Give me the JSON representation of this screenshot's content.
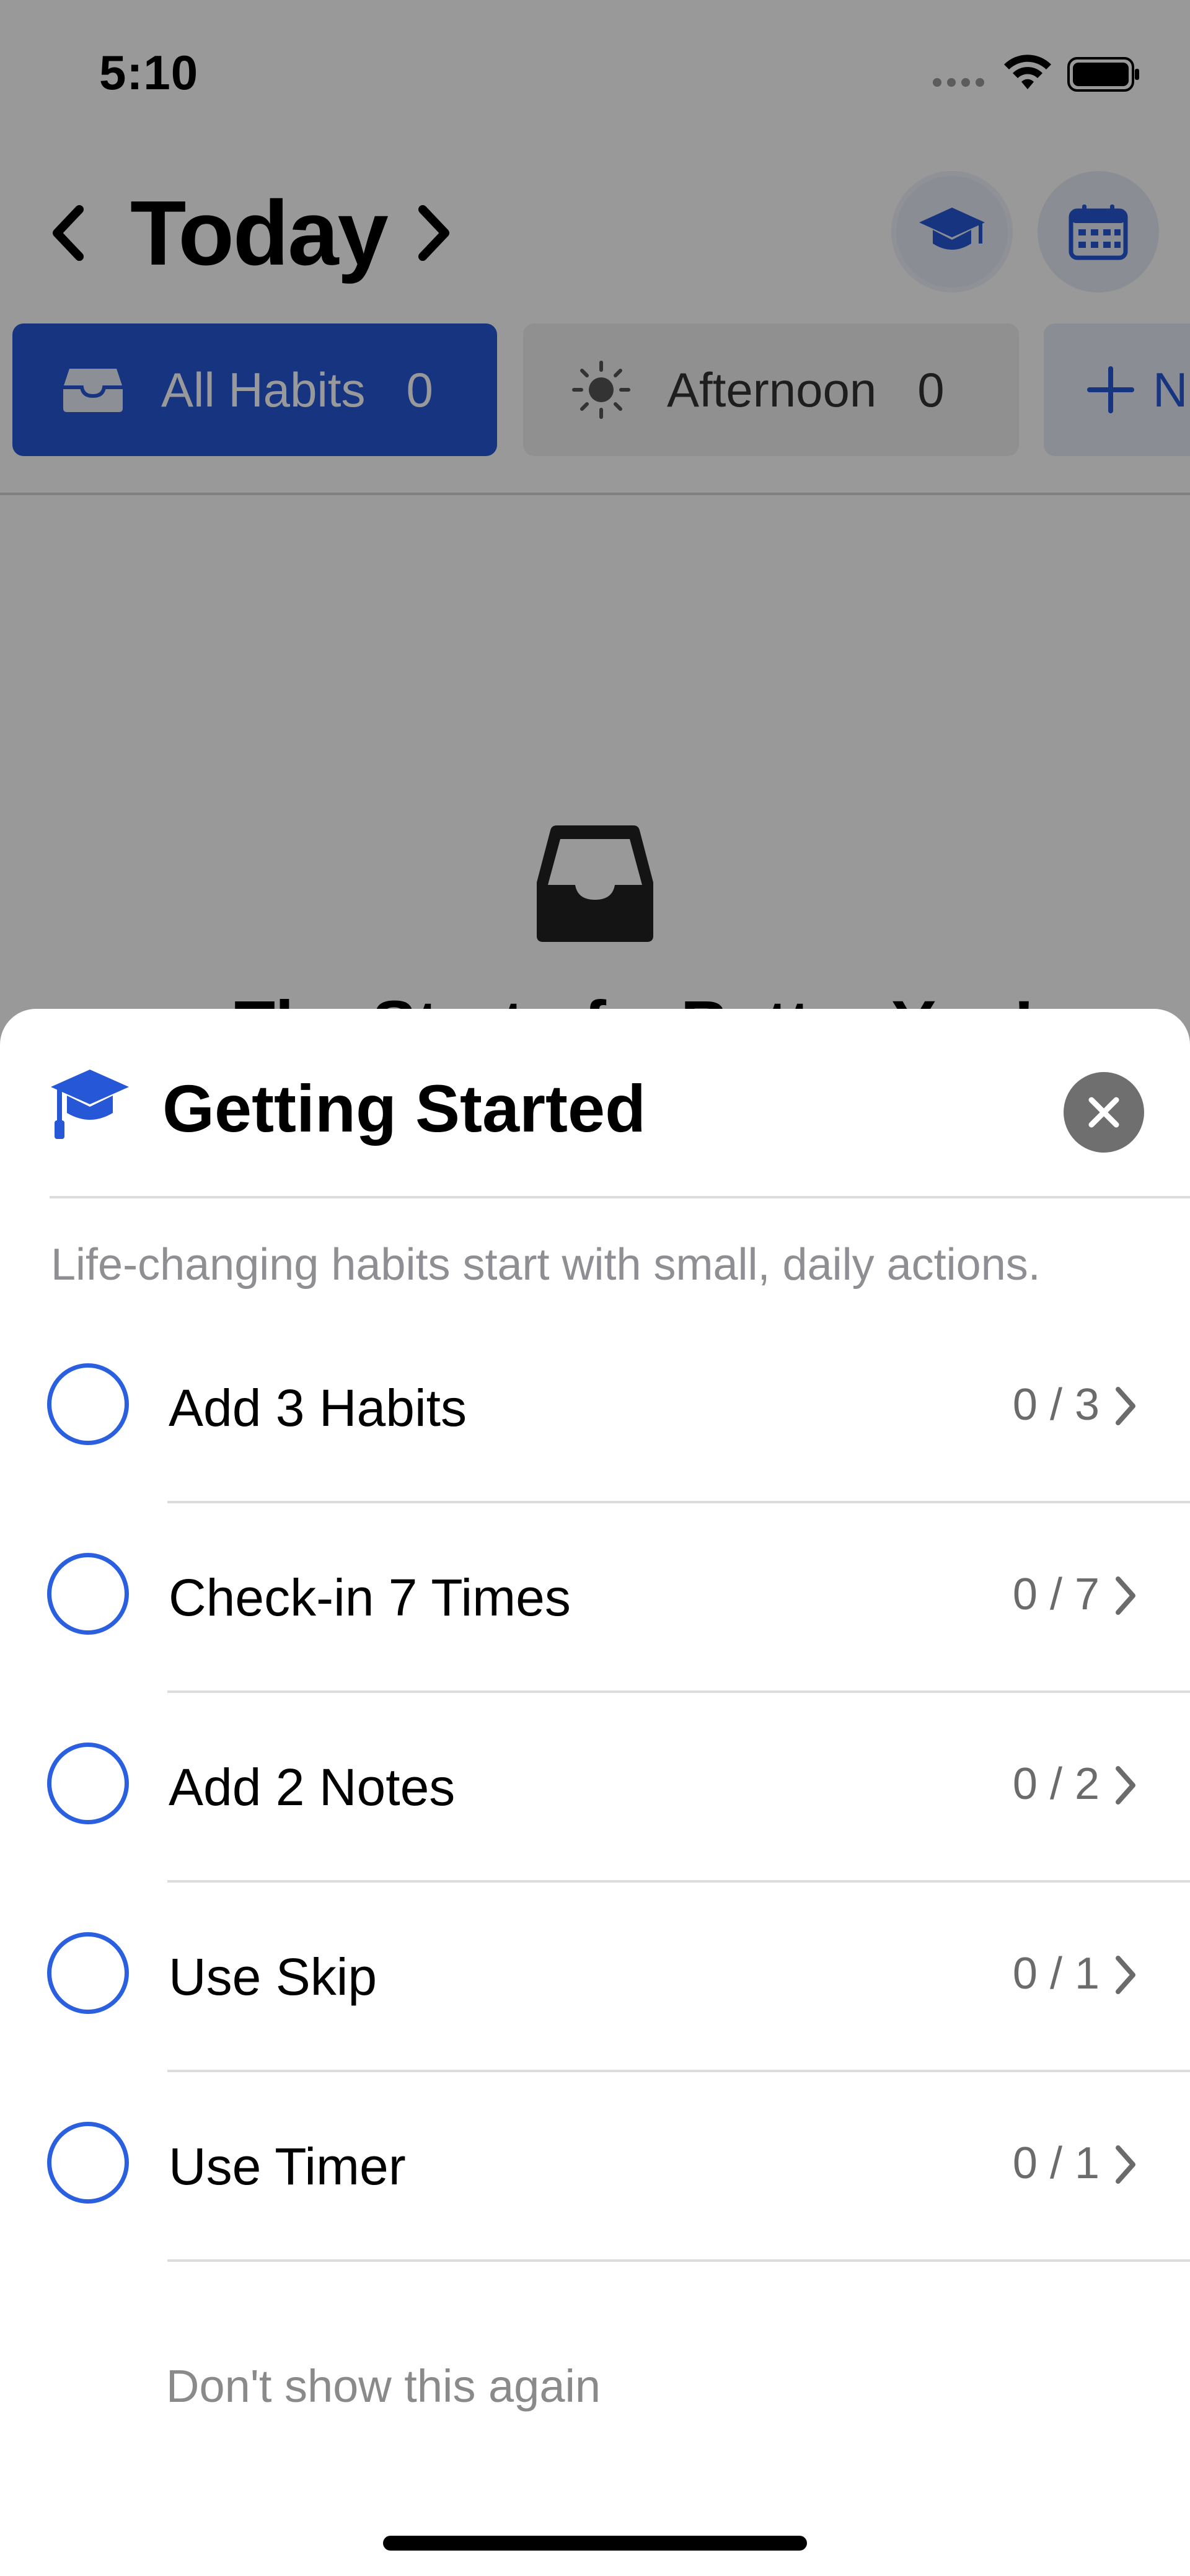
{
  "status_bar": {
    "time": "5:10"
  },
  "header": {
    "title": "Today",
    "prev_icon": "chevron-left-icon",
    "next_icon": "chevron-right-icon",
    "actions": [
      "graduation-cap-icon",
      "calendar-icon"
    ]
  },
  "tabs": [
    {
      "label": "All Habits",
      "count": "0",
      "icon": "tray-icon",
      "selected": true
    },
    {
      "label": "Afternoon",
      "count": "0",
      "icon": "sun-icon",
      "selected": false
    },
    {
      "label": "N",
      "icon": "plus-icon",
      "selected": false
    }
  ],
  "background_content": {
    "icon": "tray-icon",
    "title": "The Start of a Better You!"
  },
  "sheet": {
    "title": "Getting Started",
    "icon": "graduation-cap-icon",
    "subtitle": "Life-changing habits start with small, daily actions.",
    "tasks": [
      {
        "label": "Add 3 Habits",
        "progress": "0 / 3"
      },
      {
        "label": "Check-in 7 Times",
        "progress": "0 / 7"
      },
      {
        "label": "Add 2 Notes",
        "progress": "0 / 2"
      },
      {
        "label": "Use Skip",
        "progress": "0 / 1"
      },
      {
        "label": "Use Timer",
        "progress": "0 / 1"
      }
    ],
    "dont_show_label": "Don't show this again"
  },
  "colors": {
    "accent": "#2557d6",
    "overlay": "rgba(0,0,0,0.40)"
  }
}
